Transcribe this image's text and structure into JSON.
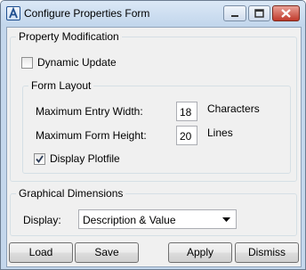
{
  "window": {
    "title": "Configure Properties Form"
  },
  "property_modification": {
    "legend": "Property Modification",
    "dynamic_update": {
      "label": "Dynamic Update",
      "checked": false
    }
  },
  "form_layout": {
    "legend": "Form Layout",
    "max_entry_width": {
      "label": "Maximum Entry Width:",
      "value": "18",
      "unit": "Characters"
    },
    "max_form_height": {
      "label": "Maximum Form Height:",
      "value": "20",
      "unit": "Lines"
    },
    "display_plotfile": {
      "label": "Display Plotfile",
      "checked": true
    }
  },
  "graphical_dimensions": {
    "legend": "Graphical Dimensions",
    "display_label": "Display:",
    "display_value": "Description & Value"
  },
  "buttons": {
    "load": "Load",
    "save": "Save",
    "apply": "Apply",
    "dismiss": "Dismiss"
  }
}
